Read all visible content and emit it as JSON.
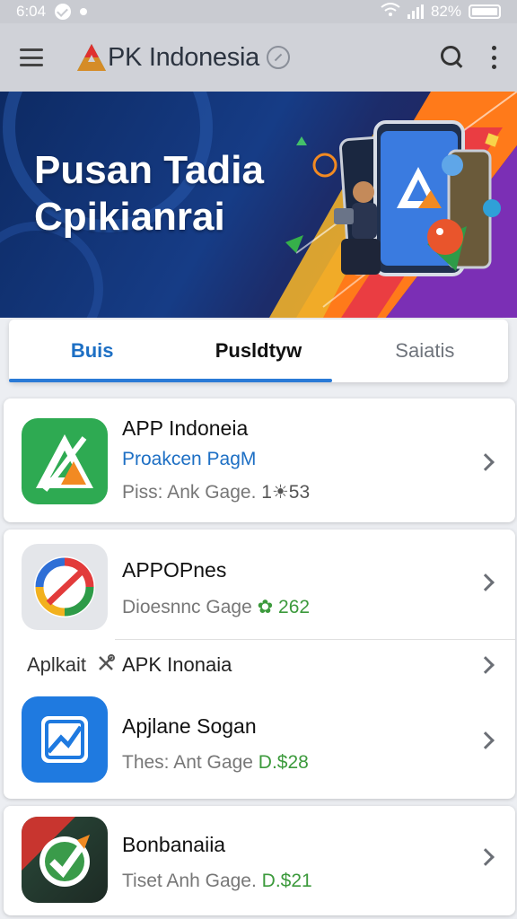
{
  "status_bar": {
    "time": "6:04",
    "battery": "82%"
  },
  "app_bar": {
    "title": "PK Indonesia"
  },
  "banner": {
    "title": "Pusan Tadia Cpikianrai"
  },
  "tabs": [
    {
      "label": "Buis",
      "active": true
    },
    {
      "label": "Pusldtyw",
      "active": false
    },
    {
      "label": "Saiatis",
      "active": false
    }
  ],
  "apps": [
    {
      "name": "APP Indoneia",
      "subtitle": "Proakcen PagM",
      "meta_prefix": "Piss: Ank Gage.",
      "meta_value": "1☀53"
    },
    {
      "name": "APPOPnes",
      "subtitle": "",
      "meta_prefix": "Dioesnnc Gage",
      "meta_value": "✿ 262"
    },
    {
      "name": "Apjlane Sogan",
      "subtitle": "",
      "meta_prefix": "Thes: Ant Gage",
      "meta_value": "D.$28"
    },
    {
      "name": "Bonbanaiia",
      "subtitle": "",
      "meta_prefix": "Tiset Anh Gage.",
      "meta_value": "D.$21"
    }
  ],
  "section": {
    "label": "Aplkait",
    "title": "APK Inonaia"
  },
  "colors": {
    "accent": "#2a7ad6",
    "subtitle_blue": "#1d6fc4",
    "meta_green": "#3c9a3c"
  }
}
